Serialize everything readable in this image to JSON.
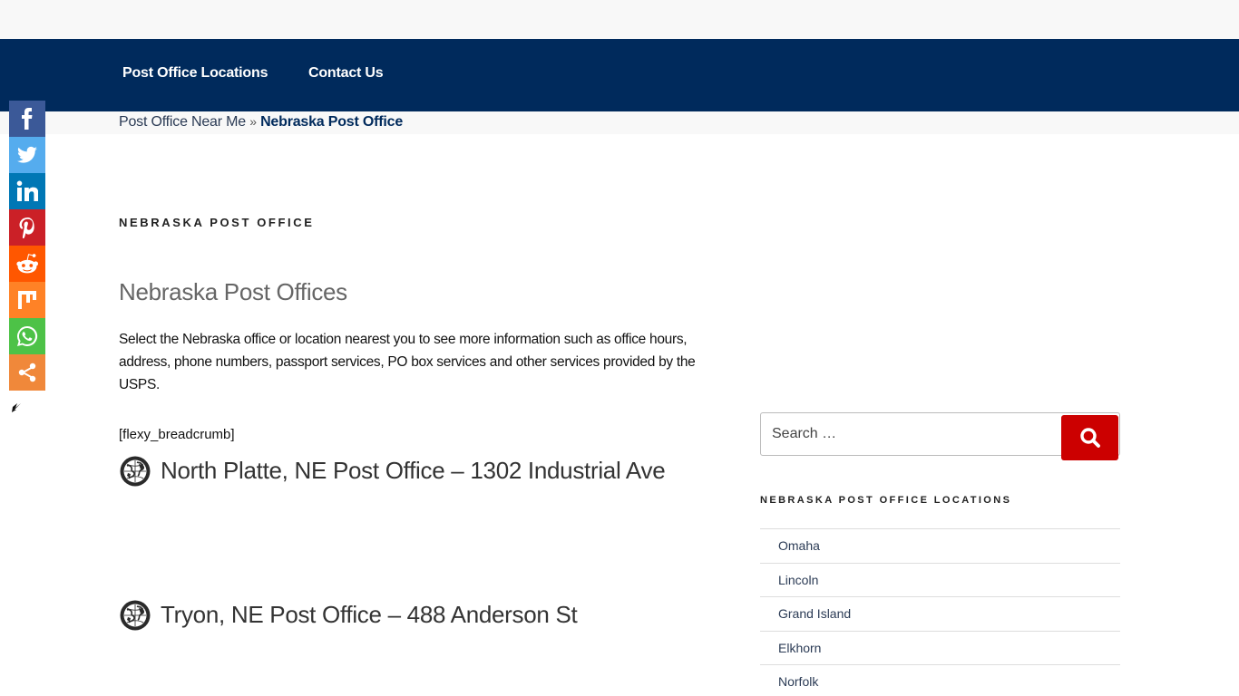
{
  "nav": {
    "items": [
      {
        "label": "Post Office Locations"
      },
      {
        "label": "Contact Us"
      }
    ],
    "background": "#002a5c"
  },
  "breadcrumb": {
    "home": "Post Office Near Me",
    "separator": "»",
    "current": "Nebraska Post Office"
  },
  "share_bar": {
    "items": [
      {
        "name": "facebook",
        "icon": "facebook-icon",
        "color": "#3b5998"
      },
      {
        "name": "twitter",
        "icon": "twitter-icon",
        "color": "#55acee"
      },
      {
        "name": "linkedin",
        "icon": "linkedin-icon",
        "color": "#0077b5"
      },
      {
        "name": "pinterest",
        "icon": "pinterest-icon",
        "color": "#cb2027"
      },
      {
        "name": "reddit",
        "icon": "reddit-icon",
        "color": "#ff5700"
      },
      {
        "name": "mix",
        "icon": "mix-icon",
        "color": "#ff8226"
      },
      {
        "name": "whatsapp",
        "icon": "whatsapp-icon",
        "color": "#4dc247"
      },
      {
        "name": "more",
        "icon": "share-icon",
        "color": "#f0883a"
      }
    ]
  },
  "page": {
    "title": "NEBRASKA POST OFFICE",
    "heading": "Nebraska Post Offices",
    "intro": "Select the Nebraska office or location nearest you to see more information such as office hours, address, phone numbers, passport services, PO box services and other services provided by the USPS.",
    "shortcode": "[flexy_breadcrumb]",
    "offices": [
      {
        "title": "North Platte, NE Post Office – 1302 Industrial Ave"
      },
      {
        "title": "Tryon, NE Post Office – 488 Anderson St"
      }
    ]
  },
  "sidebar": {
    "search": {
      "placeholder": "Search …",
      "value": "",
      "button_color": "#cc0000"
    },
    "widget_title": "NEBRASKA POST OFFICE LOCATIONS",
    "locations": [
      {
        "label": "Omaha"
      },
      {
        "label": "Lincoln"
      },
      {
        "label": "Grand Island"
      },
      {
        "label": "Elkhorn"
      },
      {
        "label": "Norfolk"
      }
    ]
  }
}
